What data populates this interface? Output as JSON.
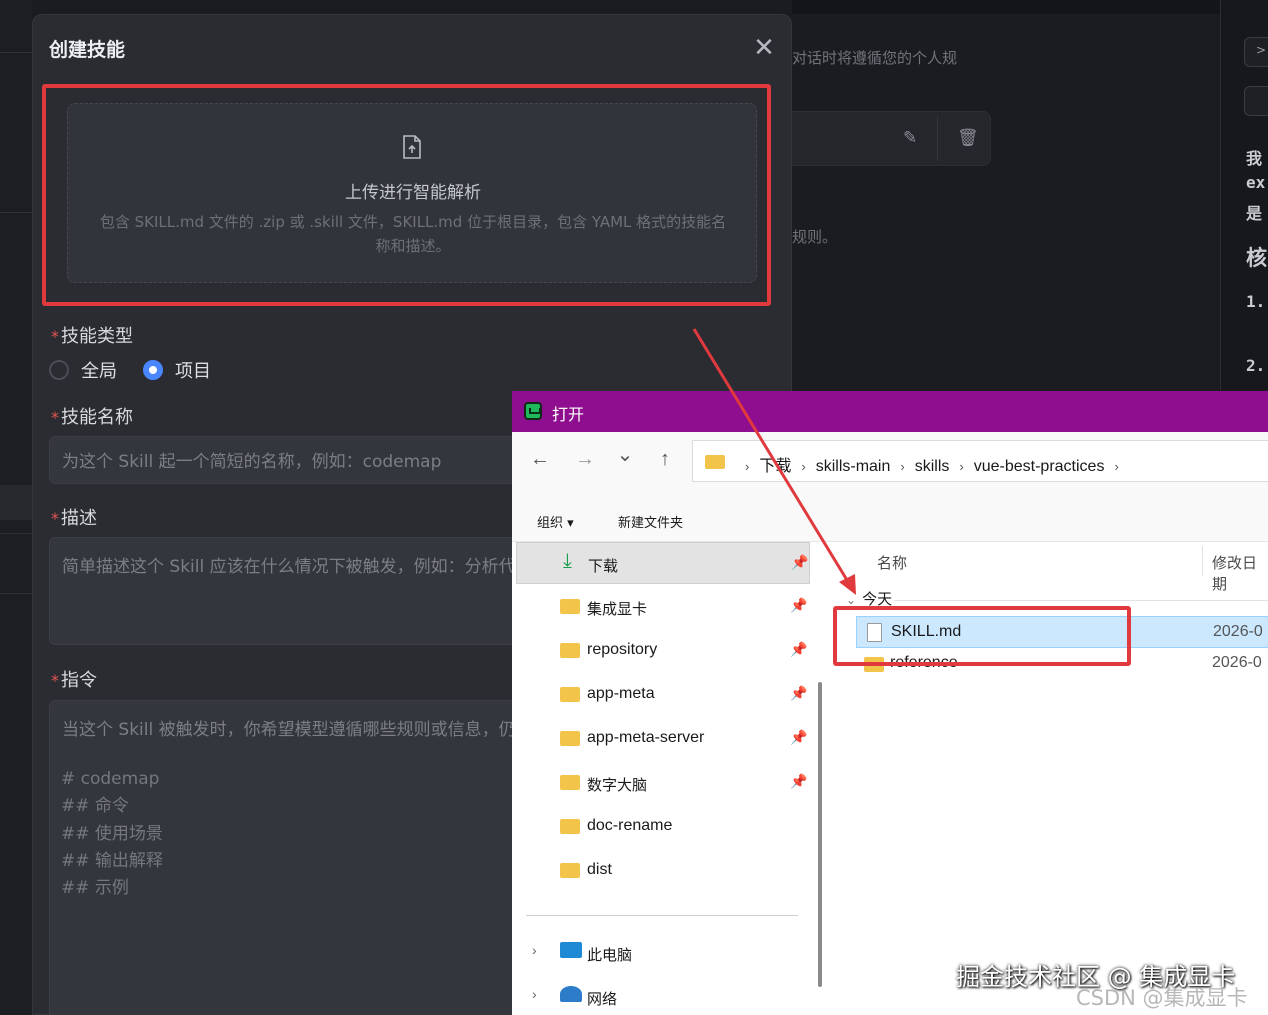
{
  "background": {
    "hint_line1": "对话时将遵循您的个人规",
    "hint_line2": "规则。",
    "edit_icon": "edit-icon",
    "delete_icon": "trash-icon",
    "right_panel": {
      "chevron": ">",
      "text_1": "我",
      "text_2": "ex",
      "text_3": "是",
      "heading": "核",
      "item_1": "1.",
      "item_2": "2."
    }
  },
  "modal": {
    "title": "创建技能",
    "close_icon": "close-icon",
    "upload": {
      "icon": "file-upload-icon",
      "title": "上传进行智能解析",
      "description": "包含 SKILL.md 文件的 .zip 或 .skill 文件，SKILL.md 位于根目录，包含 YAML 格式的技能名称和描述。"
    },
    "skill_type": {
      "label": "技能类型",
      "required_mark": "*",
      "options": [
        {
          "label": "全局",
          "checked": false
        },
        {
          "label": "项目",
          "checked": true
        }
      ]
    },
    "skill_name": {
      "label": "技能名称",
      "required_mark": "*",
      "placeholder": "为这个 Skill 起一个简短的名称，例如：codemap"
    },
    "description": {
      "label": "描述",
      "required_mark": "*",
      "placeholder": "简单描述这个 Skill 应该在什么情况下被触发，例如：分析代"
    },
    "instructions": {
      "label": "指令",
      "required_mark": "*",
      "placeholder_first": "当这个 Skill 被触发时，你希望模型遵循哪些规则或信息，仍",
      "lines": [
        "# codemap",
        "## 命令",
        "## 使用场景",
        "## 输出解释",
        "## 示例"
      ]
    }
  },
  "file_dialog": {
    "title": "打开",
    "nav": {
      "back": "←",
      "forward": "→",
      "history": "⌄",
      "up": "↑"
    },
    "breadcrumb": [
      "下载",
      "skills-main",
      "skills",
      "vue-best-practices"
    ],
    "toolbar": {
      "organize": "组织 ▾",
      "new_folder": "新建文件夹"
    },
    "sidebar": {
      "quick_access": [
        {
          "label": "下载",
          "icon": "download-icon",
          "selected": true
        },
        {
          "label": "集成显卡",
          "icon": "folder-icon"
        },
        {
          "label": "repository",
          "icon": "folder-icon"
        },
        {
          "label": "app-meta",
          "icon": "folder-icon"
        },
        {
          "label": "app-meta-server",
          "icon": "folder-icon"
        },
        {
          "label": "数字大脑",
          "icon": "folder-icon"
        },
        {
          "label": "doc-rename",
          "icon": "folder-icon"
        },
        {
          "label": "dist",
          "icon": "folder-icon"
        }
      ],
      "this_pc": "此电脑",
      "network": "网络"
    },
    "columns": {
      "name": "名称",
      "modified": "修改日期"
    },
    "group": "今天",
    "files": [
      {
        "name": "SKILL.md",
        "date": "2026-0",
        "type": "file",
        "selected": true
      },
      {
        "name": "reference",
        "date": "2026-0",
        "type": "folder",
        "selected": false
      }
    ]
  },
  "annotation_color": "#e0393e",
  "watermark": {
    "main": "掘金技术社区 @ 集成显卡",
    "secondary": "CSDN @集成显卡"
  }
}
